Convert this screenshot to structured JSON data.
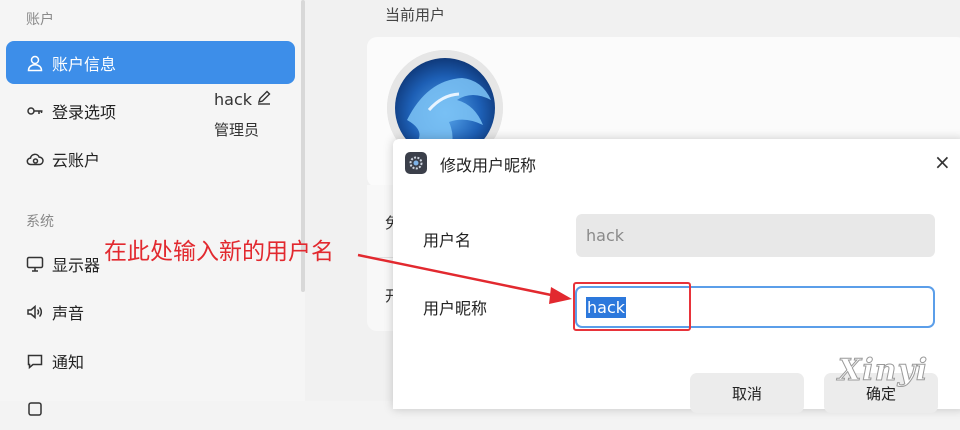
{
  "sidebar": {
    "sections": [
      {
        "title": "账户",
        "items": [
          {
            "label": "账户信息",
            "icon": "user-icon",
            "active": true
          },
          {
            "label": "登录选项",
            "icon": "key-icon",
            "active": false
          },
          {
            "label": "云账户",
            "icon": "cloud-icon",
            "active": false
          }
        ]
      },
      {
        "title": "系统",
        "items": [
          {
            "label": "显示器",
            "icon": "monitor-icon",
            "active": false
          },
          {
            "label": "声音",
            "icon": "speaker-icon",
            "active": false
          },
          {
            "label": "通知",
            "icon": "chat-bubble-icon",
            "active": false
          }
        ]
      }
    ]
  },
  "main": {
    "title": "当前用户",
    "user": {
      "name": "hack",
      "role": "管理员"
    },
    "clipped": {
      "row1": "免",
      "row2": "开"
    }
  },
  "dialog": {
    "title": "修改用户昵称",
    "close": "×",
    "username_label": "用户名",
    "username_value": "hack",
    "nickname_label": "用户昵称",
    "nickname_value": "hack",
    "cancel": "取消",
    "confirm": "确定"
  },
  "annotation": {
    "text": "在此处输入新的用户名",
    "color": "#e2292f"
  },
  "watermark": "Xinyi",
  "colors": {
    "accent": "#3d8ee9",
    "annotation_red": "#e2292f"
  }
}
